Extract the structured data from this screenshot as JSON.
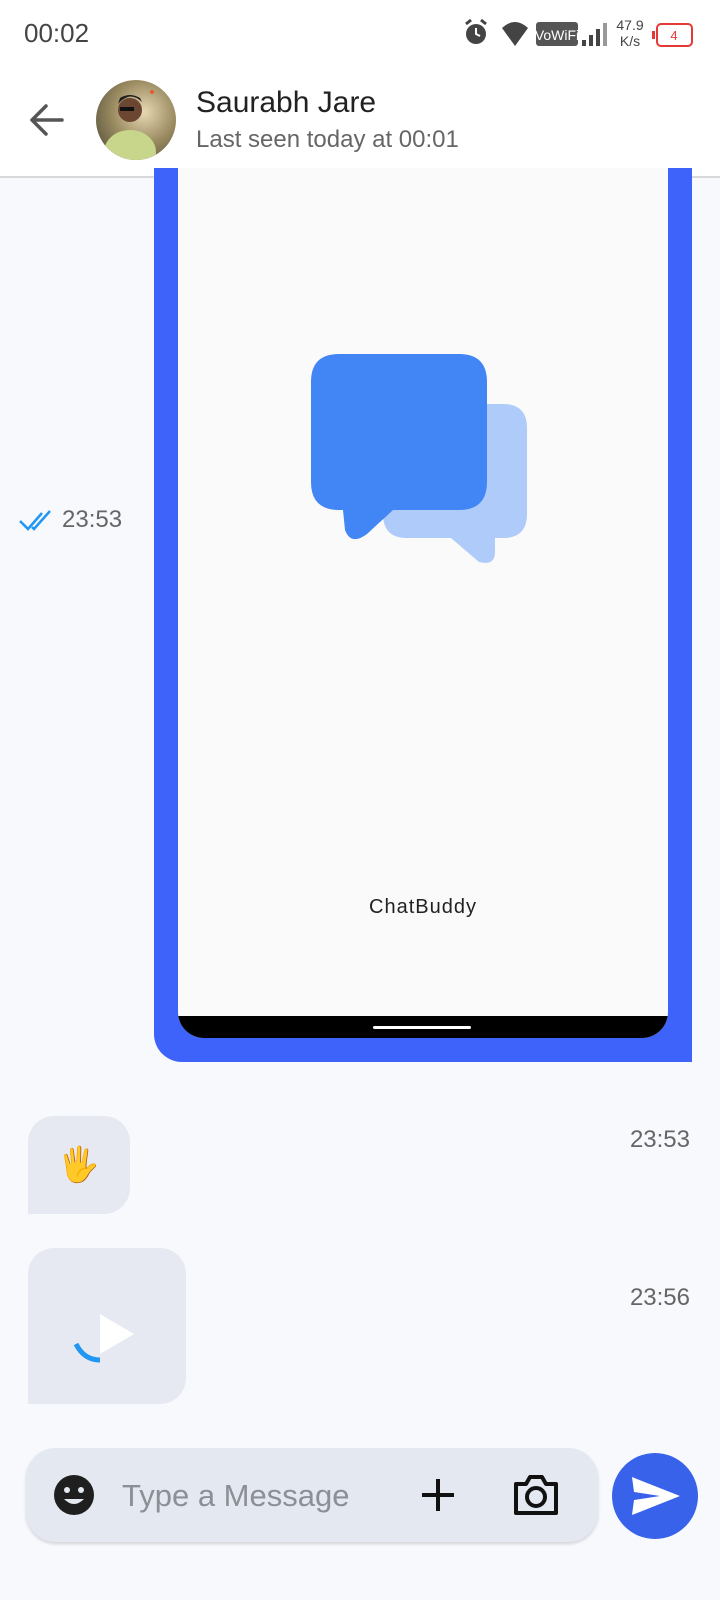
{
  "status_bar": {
    "time": "00:02",
    "network_label": "VoWiFi",
    "speed_value": "47.9",
    "speed_unit": "K/s",
    "battery": "4",
    "icons": [
      "alarm-icon",
      "wifi-icon",
      "vowifi-icon",
      "signal-icon",
      "battery-icon"
    ]
  },
  "header": {
    "name": "Saurabh Jare",
    "status": "Last seen today at 00:01"
  },
  "messages": [
    {
      "type": "image",
      "caption_in_image": "ChatBuddy",
      "time": "23:53",
      "sent": true,
      "read": true
    },
    {
      "type": "emoji",
      "content": "🖐",
      "time": "23:53",
      "sent": false
    },
    {
      "type": "video",
      "time": "23:56",
      "sent": false
    }
  ],
  "composer": {
    "placeholder": "Type a Message",
    "value": ""
  },
  "colors": {
    "accent": "#3762e9",
    "image_border": "#3d63fb",
    "read_ticks": "#2196f3",
    "bubble": "#e6e9f2"
  }
}
